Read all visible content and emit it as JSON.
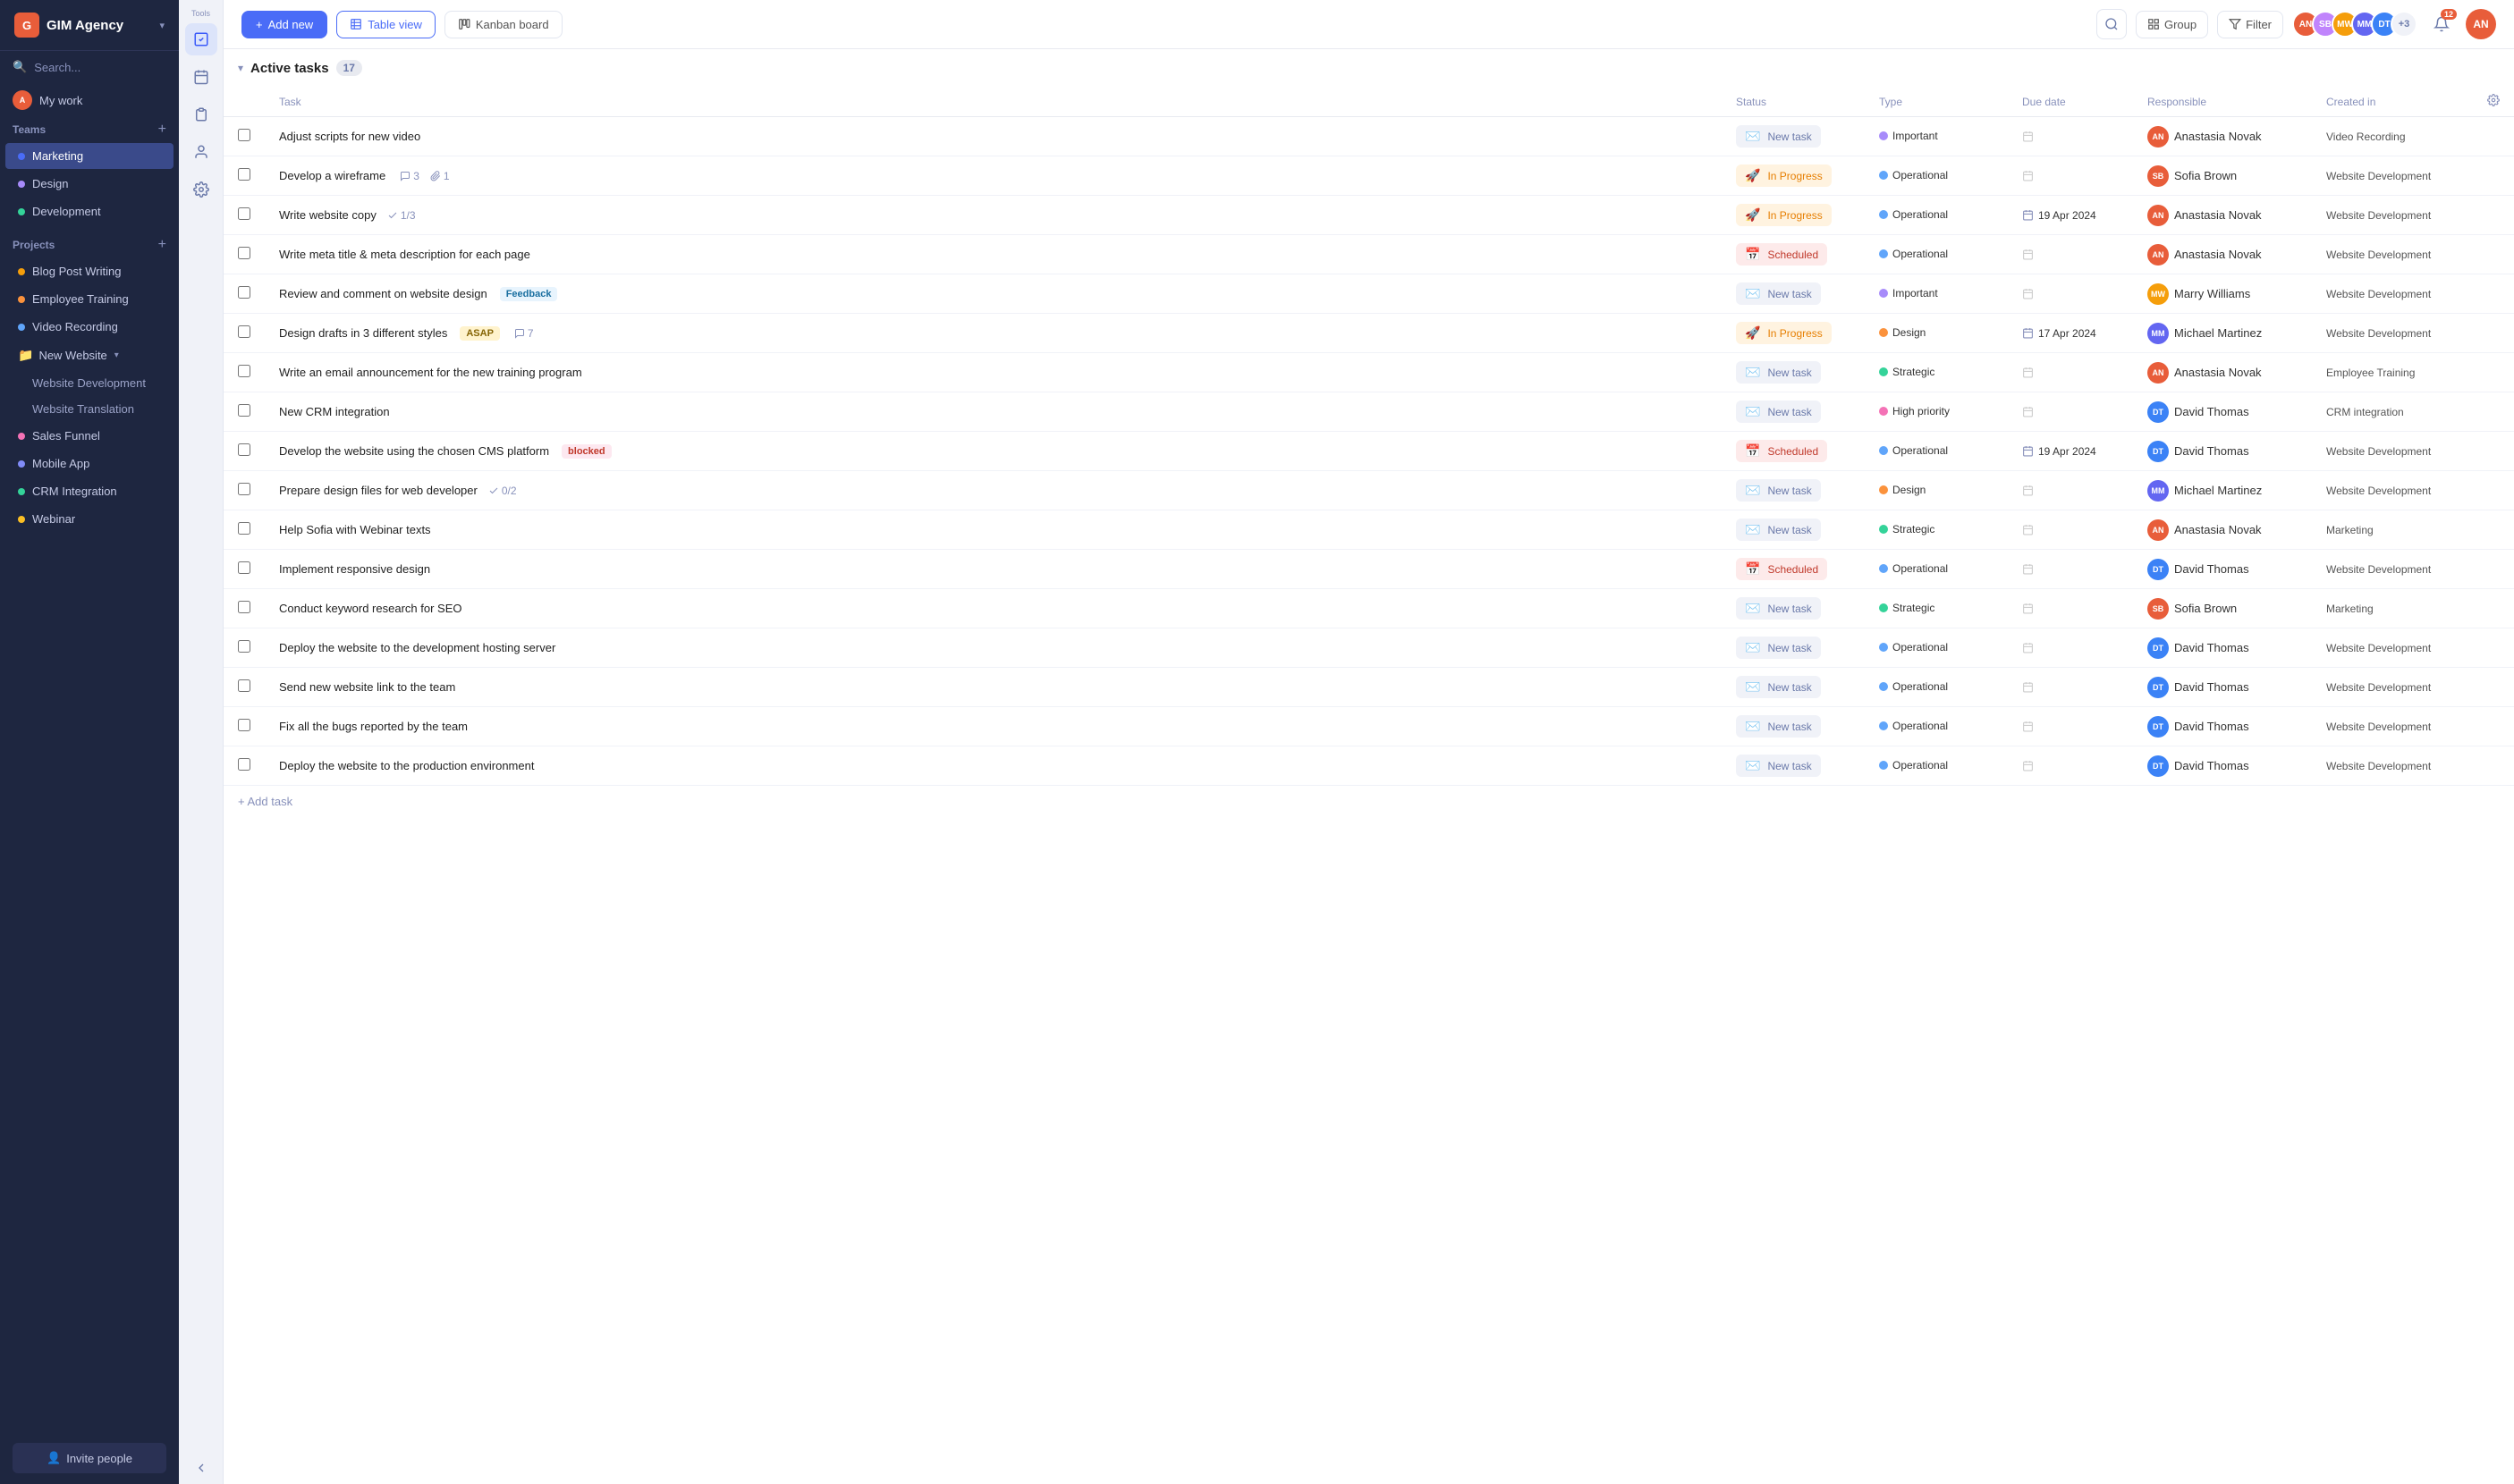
{
  "app": {
    "name": "GIM Agency",
    "logo_text": "G"
  },
  "sidebar": {
    "search_placeholder": "Search...",
    "my_work_label": "My work",
    "teams_label": "Teams",
    "teams": [
      {
        "name": "Marketing",
        "active": true
      },
      {
        "name": "Design"
      },
      {
        "name": "Development"
      }
    ],
    "projects_label": "Projects",
    "projects": [
      {
        "name": "Blog Post Writing"
      },
      {
        "name": "Employee Training"
      },
      {
        "name": "Video Recording"
      },
      {
        "name": "New Website",
        "has_children": true,
        "expanded": true
      },
      {
        "name": "Website Development",
        "sub": true
      },
      {
        "name": "Website Translation",
        "sub": true
      },
      {
        "name": "Sales Funnel"
      },
      {
        "name": "Mobile App"
      },
      {
        "name": "CRM Integration"
      },
      {
        "name": "Webinar"
      }
    ],
    "invite_label": "Invite people"
  },
  "toolbar": {
    "tools_label": "Tools",
    "add_new_label": "+ Add new",
    "table_view_label": "Table view",
    "kanban_board_label": "Kanban board",
    "group_label": "Group",
    "filter_label": "Filter",
    "avatar_count": "+3",
    "notification_count": "12"
  },
  "table": {
    "section_title": "Active tasks",
    "section_count": "17",
    "columns": {
      "task": "Task",
      "status": "Status",
      "type": "Type",
      "due_date": "Due date",
      "responsible": "Responsible",
      "created_in": "Created in"
    },
    "add_task_label": "+ Add task",
    "tasks": [
      {
        "name": "Adjust scripts for new video",
        "tags": [],
        "comments": null,
        "attachments": null,
        "subtasks": null,
        "status": "New task",
        "status_type": "new",
        "type": "Important",
        "type_color": "#a78bfa",
        "due_date": "",
        "responsible": "Anastasia Novak",
        "resp_color": "#e85d3a",
        "resp_initials": "AN",
        "created_in": "Video Recording"
      },
      {
        "name": "Develop a wireframe",
        "tags": [],
        "comments": "3",
        "attachments": "1",
        "subtasks": null,
        "status": "In Progress",
        "status_type": "progress",
        "type": "Operational",
        "type_color": "#60a5fa",
        "due_date": "",
        "responsible": "Sofia Brown",
        "resp_color": "#e85d3a",
        "resp_initials": "SB",
        "created_in": "Website Development"
      },
      {
        "name": "Write website copy",
        "tags": [],
        "comments": null,
        "attachments": null,
        "subtasks": "1/3",
        "status": "In Progress",
        "status_type": "progress",
        "type": "Operational",
        "type_color": "#60a5fa",
        "due_date": "19 Apr 2024",
        "responsible": "Anastasia Novak",
        "resp_color": "#e85d3a",
        "resp_initials": "AN",
        "created_in": "Website Development"
      },
      {
        "name": "Write meta title & meta description for each page",
        "tags": [],
        "comments": null,
        "attachments": null,
        "subtasks": null,
        "status": "Scheduled",
        "status_type": "scheduled",
        "type": "Operational",
        "type_color": "#60a5fa",
        "due_date": "",
        "responsible": "Anastasia Novak",
        "resp_color": "#e85d3a",
        "resp_initials": "AN",
        "created_in": "Website Development"
      },
      {
        "name": "Review and comment on website design",
        "tags": [
          "Feedback"
        ],
        "tag_types": [
          "feedback"
        ],
        "comments": null,
        "attachments": null,
        "subtasks": null,
        "status": "New task",
        "status_type": "new",
        "type": "Important",
        "type_color": "#a78bfa",
        "due_date": "",
        "responsible": "Marry Williams",
        "resp_color": "#f59e0b",
        "resp_initials": "MW",
        "created_in": "Website Development"
      },
      {
        "name": "Design drafts in 3 different styles",
        "tags": [
          "ASAP"
        ],
        "tag_types": [
          "asap"
        ],
        "comments": "7",
        "attachments": null,
        "subtasks": null,
        "status": "In Progress",
        "status_type": "progress",
        "type": "Design",
        "type_color": "#fb923c",
        "due_date": "17 Apr 2024",
        "responsible": "Michael Martinez",
        "resp_color": "#6366f1",
        "resp_initials": "MM",
        "created_in": "Website Development"
      },
      {
        "name": "Write an email announcement for the new training program",
        "tags": [],
        "comments": null,
        "attachments": null,
        "subtasks": null,
        "status": "New task",
        "status_type": "new",
        "type": "Strategic",
        "type_color": "#34d399",
        "due_date": "",
        "responsible": "Anastasia Novak",
        "resp_color": "#e85d3a",
        "resp_initials": "AN",
        "created_in": "Employee Training"
      },
      {
        "name": "New CRM integration",
        "tags": [],
        "comments": null,
        "attachments": null,
        "subtasks": null,
        "status": "New task",
        "status_type": "new",
        "type": "High priority",
        "type_color": "#f472b6",
        "due_date": "",
        "responsible": "David Thomas",
        "resp_color": "#3b82f6",
        "resp_initials": "DT",
        "created_in": "CRM integration"
      },
      {
        "name": "Develop the website using the chosen CMS platform",
        "tags": [
          "blocked"
        ],
        "tag_types": [
          "blocked"
        ],
        "comments": null,
        "attachments": null,
        "subtasks": null,
        "status": "Scheduled",
        "status_type": "scheduled",
        "type": "Operational",
        "type_color": "#60a5fa",
        "due_date": "19 Apr 2024",
        "responsible": "David Thomas",
        "resp_color": "#3b82f6",
        "resp_initials": "DT",
        "created_in": "Website Development"
      },
      {
        "name": "Prepare design files for web developer",
        "tags": [],
        "comments": null,
        "attachments": null,
        "subtasks": "0/2",
        "status": "New task",
        "status_type": "new",
        "type": "Design",
        "type_color": "#fb923c",
        "due_date": "",
        "responsible": "Michael Martinez",
        "resp_color": "#6366f1",
        "resp_initials": "MM",
        "created_in": "Website Development"
      },
      {
        "name": "Help Sofia with Webinar texts",
        "tags": [],
        "comments": null,
        "attachments": null,
        "subtasks": null,
        "status": "New task",
        "status_type": "new",
        "type": "Strategic",
        "type_color": "#34d399",
        "due_date": "",
        "responsible": "Anastasia Novak",
        "resp_color": "#e85d3a",
        "resp_initials": "AN",
        "created_in": "Marketing"
      },
      {
        "name": "Implement responsive design",
        "tags": [],
        "comments": null,
        "attachments": null,
        "subtasks": null,
        "status": "Scheduled",
        "status_type": "scheduled",
        "type": "Operational",
        "type_color": "#60a5fa",
        "due_date": "",
        "responsible": "David Thomas",
        "resp_color": "#3b82f6",
        "resp_initials": "DT",
        "created_in": "Website Development"
      },
      {
        "name": "Conduct keyword research for SEO",
        "tags": [],
        "comments": null,
        "attachments": null,
        "subtasks": null,
        "status": "New task",
        "status_type": "new",
        "type": "Strategic",
        "type_color": "#34d399",
        "due_date": "",
        "responsible": "Sofia Brown",
        "resp_color": "#e85d3a",
        "resp_initials": "SB",
        "created_in": "Marketing"
      },
      {
        "name": "Deploy the website to the development hosting server",
        "tags": [],
        "comments": null,
        "attachments": null,
        "subtasks": null,
        "status": "New task",
        "status_type": "new",
        "type": "Operational",
        "type_color": "#60a5fa",
        "due_date": "",
        "responsible": "David Thomas",
        "resp_color": "#3b82f6",
        "resp_initials": "DT",
        "created_in": "Website Development"
      },
      {
        "name": "Send new website link to the team",
        "tags": [],
        "comments": null,
        "attachments": null,
        "subtasks": null,
        "status": "New task",
        "status_type": "new",
        "type": "Operational",
        "type_color": "#60a5fa",
        "due_date": "",
        "responsible": "David Thomas",
        "resp_color": "#3b82f6",
        "resp_initials": "DT",
        "created_in": "Website Development"
      },
      {
        "name": "Fix all the bugs reported by the team",
        "tags": [],
        "comments": null,
        "attachments": null,
        "subtasks": null,
        "status": "New task",
        "status_type": "new",
        "type": "Operational",
        "type_color": "#60a5fa",
        "due_date": "",
        "responsible": "David Thomas",
        "resp_color": "#3b82f6",
        "resp_initials": "DT",
        "created_in": "Website Development"
      },
      {
        "name": "Deploy the website to the production environment",
        "tags": [],
        "comments": null,
        "attachments": null,
        "subtasks": null,
        "status": "New task",
        "status_type": "new",
        "type": "Operational",
        "type_color": "#60a5fa",
        "due_date": "",
        "responsible": "David Thomas",
        "resp_color": "#3b82f6",
        "resp_initials": "DT",
        "created_in": "Website Development"
      }
    ],
    "avatars": [
      {
        "initials": "AN",
        "color": "#e85d3a"
      },
      {
        "initials": "SB",
        "color": "#c084fc"
      },
      {
        "initials": "MW",
        "color": "#f59e0b"
      },
      {
        "initials": "MM",
        "color": "#6366f1"
      },
      {
        "initials": "DT",
        "color": "#3b82f6"
      }
    ]
  }
}
